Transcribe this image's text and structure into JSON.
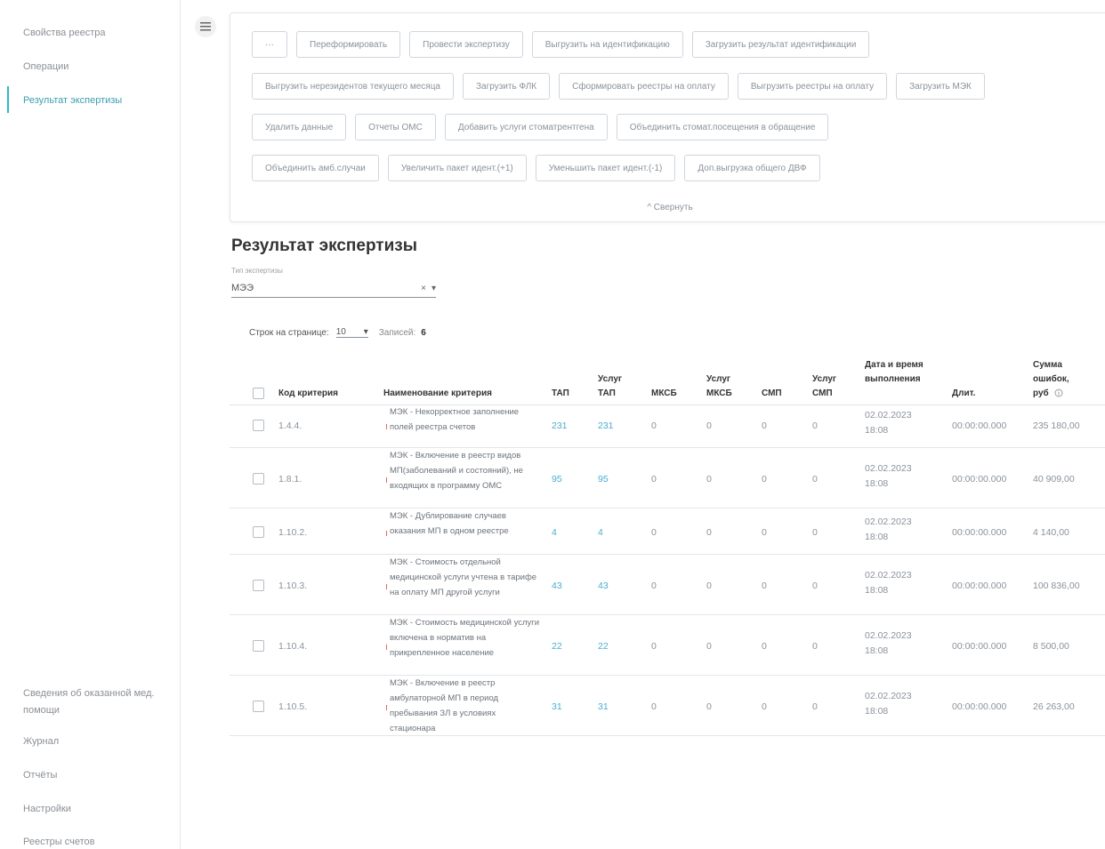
{
  "sidebar": {
    "top_items": [
      {
        "label": "Свойства реестра",
        "active": false
      },
      {
        "label": "Операции",
        "active": false
      },
      {
        "label": "Результат экспертизы",
        "active": true
      }
    ],
    "bottom_items": [
      {
        "label": "Сведения об оказанной мед. помощи"
      },
      {
        "label": "Журнал"
      },
      {
        "label": "Отчёты"
      },
      {
        "label": "Настройки"
      },
      {
        "label": "Реестры счетов"
      }
    ]
  },
  "operations": {
    "rows": [
      [
        "···",
        "Переформировать",
        "Провести экспертизу",
        "Выгрузить на идентификацию",
        "Загрузить результат идентификации"
      ],
      [
        "Выгрузить нерезидентов текущего месяца",
        "Загрузить ФЛК",
        "Сформировать реестры на оплату",
        "Выгрузить реестры на оплату",
        "Загрузить МЭК"
      ],
      [
        "Удалить данные",
        "Отчеты ОМС",
        "Добавить услуги стоматрентгена",
        "Объединить стомат.посещения в обращение"
      ],
      [
        "Объединить амб.случаи",
        "Увеличить пакет идент.(+1)",
        "Уменьшить пакет идент.(-1)",
        "Доп.выгрузка общего ДВФ"
      ]
    ],
    "collapse_label": "^ Свернуть"
  },
  "page": {
    "title": "Результат экспертизы",
    "filter_label": "Тип экспертизы",
    "filter_value": "МЭЭ",
    "clear_icon": "×",
    "dropdown_icon": "▾"
  },
  "pager": {
    "rows_label": "Строк на странице:",
    "rows_value": "10",
    "records_label": "Записей:",
    "records_count": "6"
  },
  "table": {
    "headers": {
      "code": "Код критерия",
      "name": "Наименование критерия",
      "tap": "ТАП",
      "uslug_tap": "Услуг ТАП",
      "mksb": "МКСБ",
      "uslug_mksb": "Услуг МКСБ",
      "smp": "СМП",
      "uslug_smp": "Услуг СМП",
      "datetime": "Дата и время выполнения",
      "duration": "Длит.",
      "sum": "Сумма ошибок, руб"
    },
    "rows": [
      {
        "code": "1.4.4.",
        "name": "МЭК - Некорректное заполнение полей реестра счетов",
        "tap": "231",
        "uslug_tap": "231",
        "mksb": "0",
        "uslug_mksb": "0",
        "smp": "0",
        "uslug_smp": "0",
        "date": "02.02.2023",
        "time": "18:08",
        "duration": "00:00:00.000",
        "sum": "235 180,00"
      },
      {
        "code": "1.8.1.",
        "name": "МЭК - Включение в реестр видов МП(заболеваний и состояний), не входящих в программу ОМС",
        "tap": "95",
        "uslug_tap": "95",
        "mksb": "0",
        "uslug_mksb": "0",
        "smp": "0",
        "uslug_smp": "0",
        "date": "02.02.2023",
        "time": "18:08",
        "duration": "00:00:00.000",
        "sum": "40 909,00"
      },
      {
        "code": "1.10.2.",
        "name": "МЭК - Дублирование случаев оказания МП в одном реестре",
        "tap": "4",
        "uslug_tap": "4",
        "mksb": "0",
        "uslug_mksb": "0",
        "smp": "0",
        "uslug_smp": "0",
        "date": "02.02.2023",
        "time": "18:08",
        "duration": "00:00:00.000",
        "sum": "4 140,00"
      },
      {
        "code": "1.10.3.",
        "name": "МЭК - Стоимость отдельной медицинской услуги учтена в тарифе на оплату МП другой услуги",
        "tap": "43",
        "uslug_tap": "43",
        "mksb": "0",
        "uslug_mksb": "0",
        "smp": "0",
        "uslug_smp": "0",
        "date": "02.02.2023",
        "time": "18:08",
        "duration": "00:00:00.000",
        "sum": "100 836,00"
      },
      {
        "code": "1.10.4.",
        "name": "МЭК - Стоимость медицинской услуги включена в норматив на прикрепленное население",
        "tap": "22",
        "uslug_tap": "22",
        "mksb": "0",
        "uslug_mksb": "0",
        "smp": "0",
        "uslug_smp": "0",
        "date": "02.02.2023",
        "time": "18:08",
        "duration": "00:00:00.000",
        "sum": "8 500,00"
      },
      {
        "code": "1.10.5.",
        "name": "МЭК - Включение в реестр амбулаторной МП в период пребывания ЗЛ в условиях стационара",
        "tap": "31",
        "uslug_tap": "31",
        "mksb": "0",
        "uslug_mksb": "0",
        "smp": "0",
        "uslug_smp": "0",
        "date": "02.02.2023",
        "time": "18:08",
        "duration": "00:00:00.000",
        "sum": "26 263,00"
      }
    ]
  },
  "colors": {
    "accent": "#2fb8cc",
    "link": "#4aaed0",
    "mark": "#e06666"
  }
}
